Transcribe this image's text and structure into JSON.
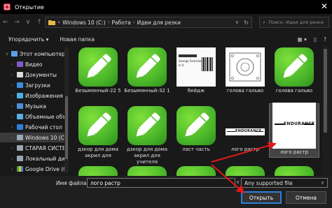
{
  "window": {
    "title": "Открытие",
    "close_symbol": "✕"
  },
  "address": {
    "root_glyph": "«",
    "crumbs": [
      "Windows 10 (C:)",
      "Работа",
      "Идеи для резки"
    ],
    "chevron": "∨"
  },
  "search": {
    "placeholder": "Поиск: Идеи для резки"
  },
  "toolbar": {
    "organize": "Упорядочить ▾",
    "new_folder": "Новая папка"
  },
  "sidebar": {
    "items": [
      {
        "label": "Этот компьютер",
        "icon": "computer-icon"
      },
      {
        "label": "Видео",
        "icon": "video-icon"
      },
      {
        "label": "Документы",
        "icon": "documents-icon"
      },
      {
        "label": "Загрузки",
        "icon": "downloads-icon"
      },
      {
        "label": "Изображения",
        "icon": "pictures-icon"
      },
      {
        "label": "Музыка",
        "icon": "music-icon"
      },
      {
        "label": "Объемные объ",
        "icon": "3d-objects-icon"
      },
      {
        "label": "Рабочий стол",
        "icon": "desktop-icon"
      },
      {
        "label": "Windows 10 (C:)",
        "icon": "drive-icon"
      },
      {
        "label": "СТАРАЯ СИСТЕ",
        "icon": "drive-icon"
      },
      {
        "label": "Локальный дис",
        "icon": "drive-icon"
      },
      {
        "label": "Google Drive (G",
        "icon": "google-drive-icon"
      }
    ]
  },
  "files": [
    {
      "name": "Безымянный-22 5",
      "kind": "app-icon"
    },
    {
      "name": "Безымянный-32 1",
      "kind": "app-icon"
    },
    {
      "name": "бейдж",
      "kind": "document"
    },
    {
      "name": "голова гальво",
      "kind": "drawing"
    },
    {
      "name": "голова гальво",
      "kind": "app-icon"
    },
    {
      "name": "дзкор для дома акрил для",
      "kind": "app-icon"
    },
    {
      "name": "дзкор для дома акрил для учителя",
      "kind": "app-icon"
    },
    {
      "name": "ласт часть",
      "kind": "app-icon"
    },
    {
      "name": "лого растр",
      "kind": "logo-strip"
    },
    {
      "name": "лого растр",
      "kind": "logo"
    }
  ],
  "doc_thumb": {
    "line1": "George Fomichev",
    "line2": "Is it"
  },
  "logo_text": "ENDURANCE",
  "footer": {
    "filename_label": "Имя файла:",
    "filename_value": "лого растр",
    "filetype_value": "Any supported file",
    "open_label": "Открыть",
    "cancel_label": "Отмена"
  },
  "colors": {
    "accent": "#2f7fd9",
    "annotation_arrow": "#e01a1a",
    "app_green": "#4cb82a"
  }
}
